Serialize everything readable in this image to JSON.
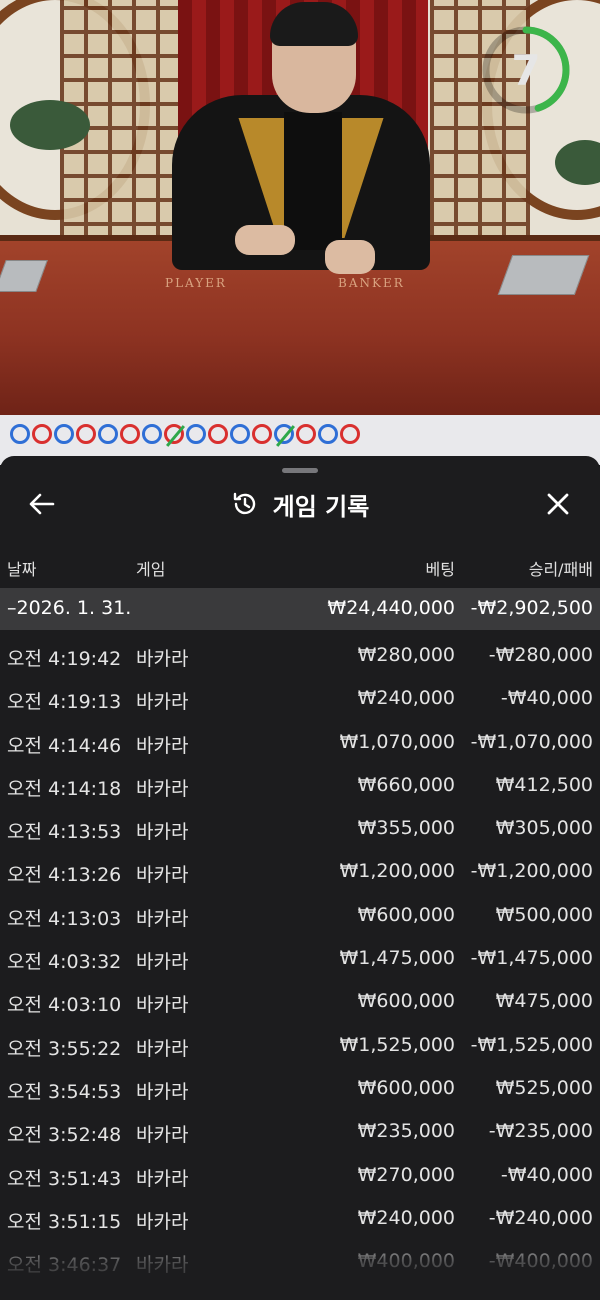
{
  "video": {
    "table_labels": {
      "player": "PLAYER",
      "banker": "BANKER"
    },
    "countdown": "7",
    "countdown_fraction": 0.45,
    "timer_color": "#3cb54a"
  },
  "roadmap": {
    "beads": [
      {
        "side": "p",
        "tie": false
      },
      {
        "side": "b",
        "tie": false
      },
      {
        "side": "p",
        "tie": false
      },
      {
        "side": "b",
        "tie": false
      },
      {
        "side": "p",
        "tie": false
      },
      {
        "side": "b",
        "tie": false
      },
      {
        "side": "p",
        "tie": false
      },
      {
        "side": "b",
        "tie": true
      },
      {
        "side": "p",
        "tie": false
      },
      {
        "side": "b",
        "tie": false
      },
      {
        "side": "p",
        "tie": false
      },
      {
        "side": "b",
        "tie": false
      },
      {
        "side": "p",
        "tie": true
      },
      {
        "side": "b",
        "tie": false
      },
      {
        "side": "p",
        "tie": false
      },
      {
        "side": "b",
        "tie": false
      }
    ],
    "colors": {
      "player": "#2f6fd6",
      "banker": "#d9302f",
      "tie": "#2ea84a"
    }
  },
  "sheet": {
    "back_icon": "arrow-left-icon",
    "history_icon": "history-icon",
    "title": "게임 기록",
    "close_icon": "close-icon"
  },
  "table": {
    "headers": {
      "date": "날짜",
      "game": "게임",
      "bet": "베팅",
      "result": "승리/패배"
    },
    "summary": {
      "date": "–2026. 1. 31.",
      "bet": "₩24,440,000",
      "result": "-₩2,902,500"
    },
    "rows": [
      {
        "time": "오전 4:19:42",
        "game": "바카라",
        "bet": "₩280,000",
        "result": "-₩280,000"
      },
      {
        "time": "오전 4:19:13",
        "game": "바카라",
        "bet": "₩240,000",
        "result": "-₩40,000"
      },
      {
        "time": "오전 4:14:46",
        "game": "바카라",
        "bet": "₩1,070,000",
        "result": "-₩1,070,000"
      },
      {
        "time": "오전 4:14:18",
        "game": "바카라",
        "bet": "₩660,000",
        "result": "₩412,500"
      },
      {
        "time": "오전 4:13:53",
        "game": "바카라",
        "bet": "₩355,000",
        "result": "₩305,000"
      },
      {
        "time": "오전 4:13:26",
        "game": "바카라",
        "bet": "₩1,200,000",
        "result": "-₩1,200,000"
      },
      {
        "time": "오전 4:13:03",
        "game": "바카라",
        "bet": "₩600,000",
        "result": "₩500,000"
      },
      {
        "time": "오전 4:03:32",
        "game": "바카라",
        "bet": "₩1,475,000",
        "result": "-₩1,475,000"
      },
      {
        "time": "오전 4:03:10",
        "game": "바카라",
        "bet": "₩600,000",
        "result": "₩475,000"
      },
      {
        "time": "오전 3:55:22",
        "game": "바카라",
        "bet": "₩1,525,000",
        "result": "-₩1,525,000"
      },
      {
        "time": "오전 3:54:53",
        "game": "바카라",
        "bet": "₩600,000",
        "result": "₩525,000"
      },
      {
        "time": "오전 3:52:48",
        "game": "바카라",
        "bet": "₩235,000",
        "result": "-₩235,000"
      },
      {
        "time": "오전 3:51:43",
        "game": "바카라",
        "bet": "₩270,000",
        "result": "-₩40,000"
      },
      {
        "time": "오전 3:51:15",
        "game": "바카라",
        "bet": "₩240,000",
        "result": "-₩240,000"
      },
      {
        "time": "오전 3:46:37",
        "game": "바카라",
        "bet": "₩400,000",
        "result": "-₩400,000"
      }
    ]
  }
}
